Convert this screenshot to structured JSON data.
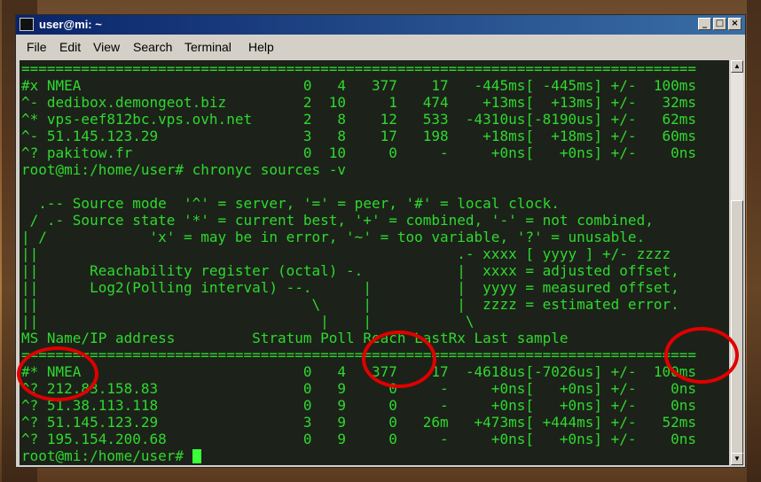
{
  "window": {
    "title": "user@mi: ~",
    "controls": {
      "minimize": "_",
      "maximize": "□",
      "close": "×"
    }
  },
  "menu": [
    "File",
    "Edit",
    "View",
    "Search",
    "Terminal",
    "Help"
  ],
  "terminal": {
    "lines": [
      "===============================================================================",
      "#x NMEA                          0   4   377    17   -445ms[ -445ms] +/-  100ms",
      "^- dedibox.demongeot.biz         2  10     1   474    +13ms[  +13ms] +/-   32ms",
      "^* vps-eef812bc.vps.ovh.net      2   8    12   533  -4310us[-8190us] +/-   62ms",
      "^- 51.145.123.29                 3   8    17   198    +18ms[  +18ms] +/-   60ms",
      "^? pakitow.fr                    0  10     0     -     +0ns[   +0ns] +/-    0ns",
      "root@mi:/home/user# chronyc sources -v",
      "",
      "  .-- Source mode  '^' = server, '=' = peer, '#' = local clock.",
      " / .- Source state '*' = current best, '+' = combined, '-' = not combined,",
      "| /            'x' = may be in error, '~' = too variable, '?' = unusable.",
      "||                                                 .- xxxx [ yyyy ] +/- zzzz",
      "||      Reachability register (octal) -.           |  xxxx = adjusted offset,",
      "||      Log2(Polling interval) --.      |          |  yyyy = measured offset,",
      "||                                \\     |          |  zzzz = estimated error.",
      "||                                 |    |           \\",
      "MS Name/IP address         Stratum Poll Reach LastRx Last sample",
      "===============================================================================",
      "#* NMEA                          0   4   377    17  -4618us[-7026us] +/-  100ms",
      "^? 212.83.158.83                 0   9     0     -     +0ns[   +0ns] +/-    0ns",
      "^? 51.38.113.118                 0   9     0     -     +0ns[   +0ns] +/-    0ns",
      "^? 51.145.123.29                 3   9     0   26m   +473ms[ +444ms] +/-   52ms",
      "^? 195.154.200.68                0   9     0     -     +0ns[   +0ns] +/-    0ns"
    ],
    "prompt": "root@mi:/home/user# "
  },
  "colors": {
    "terminal_text": "#2fd82f",
    "annotation": "#e00000",
    "titlebar": "#0a246a"
  }
}
